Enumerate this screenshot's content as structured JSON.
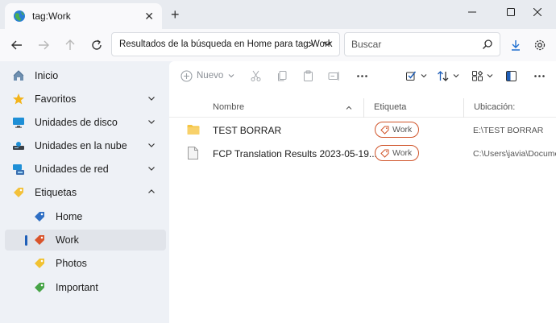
{
  "window": {
    "tab_title": "tag:Work",
    "tab_close": "✕",
    "new_tab": "+"
  },
  "nav": {
    "address": "Resultados de la búsqueda en Home para tag:Work",
    "address_sep": ">",
    "search_placeholder": "Buscar"
  },
  "sidebar": {
    "items": [
      {
        "label": "Inicio"
      },
      {
        "label": "Favoritos"
      },
      {
        "label": "Unidades de disco"
      },
      {
        "label": "Unidades en la nube"
      },
      {
        "label": "Unidades de red"
      },
      {
        "label": "Etiquetas"
      },
      {
        "label": "Home",
        "color": "#2f6fc4"
      },
      {
        "label": "Work",
        "color": "#d9542b"
      },
      {
        "label": "Photos",
        "color": "#f1c232"
      },
      {
        "label": "Important",
        "color": "#47a447"
      }
    ]
  },
  "toolbar": {
    "new_label": "Nuevo"
  },
  "columns": {
    "name": "Nombre",
    "tag": "Etiqueta",
    "location": "Ubicación:"
  },
  "files": [
    {
      "name": "TEST BORRAR",
      "tag": "Work",
      "location": "E:\\TEST BORRAR",
      "type": "folder"
    },
    {
      "name": "FCP Translation Results 2023-05-19...",
      "tag": "Work",
      "location": "C:\\Users\\javia\\Documents",
      "type": "file"
    }
  ],
  "colors": {
    "accent": "#1f5fb8",
    "tag_work": "#d0542a",
    "folder": "#f5c542"
  }
}
